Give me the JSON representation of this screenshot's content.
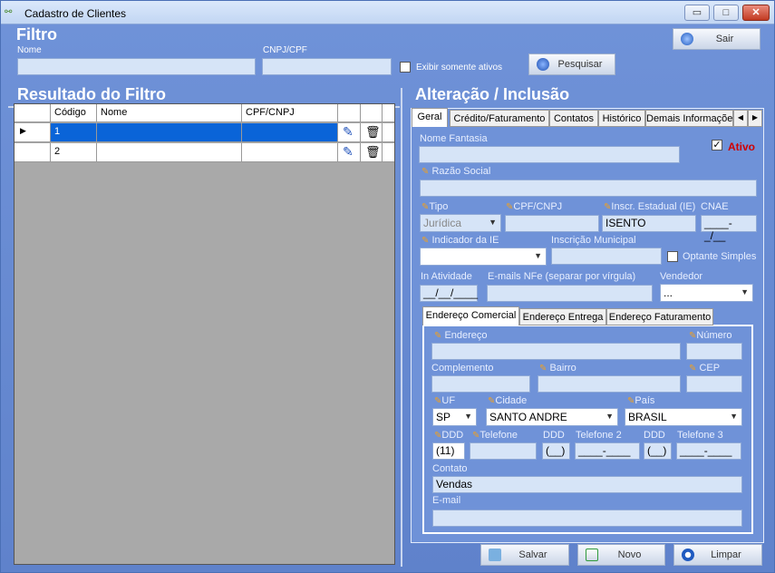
{
  "window": {
    "title": "Cadastro de Clientes",
    "min": "▭",
    "max": "□",
    "close": "✕"
  },
  "filter": {
    "heading": "Filtro",
    "nome_label": "Nome",
    "cnpj_label": "CNPJ/CPF",
    "nome_value": "",
    "cnpj_value": "",
    "only_active_label": "Exibir somente ativos",
    "search_button": "Pesquisar",
    "exit_button": "Sair"
  },
  "results": {
    "heading": "Resultado do Filtro",
    "columns": [
      "Código",
      "Nome",
      "CPF/CNPJ"
    ],
    "rows": [
      {
        "codigo": "1",
        "nome": "",
        "cpf": ""
      },
      {
        "codigo": "2",
        "nome": "",
        "cpf": ""
      }
    ]
  },
  "edit": {
    "heading": "Alteração / Inclusão",
    "tabs": [
      "Geral",
      "Crédito/Faturamento",
      "Contatos",
      "Histórico",
      "Demais Informaçõe"
    ],
    "nome_fantasia_label": "Nome Fantasia",
    "nome_fantasia_value": "",
    "ativo_label": "Ativo",
    "razao_social_label": "Razão Social",
    "razao_social_value": "",
    "tipo_label": "Tipo",
    "tipo_value": "Jurídica",
    "cpfcnpj_label": "CPF/CNPJ",
    "cpfcnpj_value": "",
    "ie_label": "Inscr. Estadual (IE)",
    "ie_value": "ISENTO",
    "cnae_label": "CNAE",
    "cnae_value": "____-_/__",
    "indicador_label": "Indicador da  IE",
    "indicador_value": "",
    "insc_municipal_label": "Inscrição Municipal",
    "insc_municipal_value": "",
    "optante_label": "Optante Simples",
    "inatividade_label": "In Atividade",
    "inatividade_value": "__/__/____",
    "emails_label": "E-mails NFe (separar por vírgula)",
    "emails_value": "",
    "vendedor_label": "Vendedor",
    "vendedor_value": "...",
    "addr_tabs": [
      "Endereço Comercial",
      "Endereço Entrega",
      "Endereço Faturamento"
    ],
    "endereco_label": "Endereço",
    "numero_label": "Número",
    "complemento_label": "Complemento",
    "bairro_label": "Bairro",
    "cep_label": "CEP",
    "uf_label": "UF",
    "uf_value": "SP",
    "cidade_label": "Cidade",
    "cidade_value": "SANTO ANDRE",
    "pais_label": "País",
    "pais_value": "BRASIL",
    "ddd_label": "DDD",
    "ddd_value": "(11)",
    "telefone_label": "Telefone",
    "ddd2_label": "DDD",
    "ddd2_value": "(__)",
    "telefone2_label": "Telefone 2",
    "telefone2_value": "____-____",
    "ddd3_label": "DDD",
    "ddd3_value": "(__)",
    "telefone3_label": "Telefone 3",
    "telefone3_value": "____-____",
    "contato_label": "Contato",
    "contato_value": "Vendas",
    "email_label": "E-mail",
    "email_value": ""
  },
  "actions": {
    "save": "Salvar",
    "new": "Novo",
    "clear": "Limpar"
  }
}
